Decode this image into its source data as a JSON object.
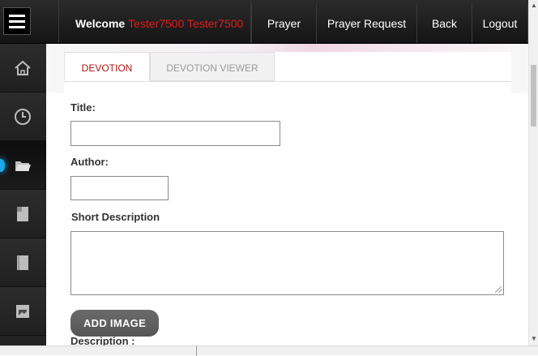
{
  "header": {
    "welcome_label": "Welcome",
    "user_name": "Tester7500 Tester7500",
    "nav": [
      {
        "label": "Prayer"
      },
      {
        "label": "Prayer Request"
      },
      {
        "label": "Back"
      },
      {
        "label": "Logout"
      }
    ]
  },
  "sidebar": {
    "items": [
      {
        "icon": "home-icon"
      },
      {
        "icon": "clock-icon"
      },
      {
        "icon": "folder-icon",
        "active": true
      },
      {
        "icon": "document-icon"
      },
      {
        "icon": "book-icon"
      },
      {
        "icon": "gallery-icon"
      }
    ]
  },
  "tabs": [
    {
      "label": "DEVOTION",
      "active": true
    },
    {
      "label": "DEVOTION VIEWER",
      "active": false
    }
  ],
  "form": {
    "title_label": "Title:",
    "title_value": "",
    "author_label": "Author:",
    "author_value": "",
    "short_desc_label": "Short Description",
    "short_desc_value": "",
    "add_image_label": "ADD IMAGE",
    "description_label": "Description :"
  },
  "colors": {
    "accent_red": "#e41a1a",
    "tab_active_red": "#b01515",
    "sidebar_glow": "#1aa8e8"
  }
}
